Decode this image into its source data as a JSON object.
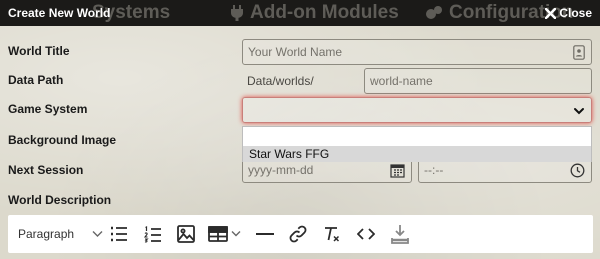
{
  "header": {
    "title": "Create New World",
    "bg_tabs": [
      "Systems",
      "Add-on Modules",
      "Configuration"
    ],
    "close_label": "Close"
  },
  "form": {
    "world_title": {
      "label": "World Title",
      "placeholder": "Your World Name",
      "value": ""
    },
    "data_path": {
      "label": "Data Path",
      "prefix": "Data/worlds/",
      "placeholder": "world-name",
      "value": ""
    },
    "game_system": {
      "label": "Game System",
      "selected": "",
      "options": [
        "Star Wars FFG"
      ]
    },
    "background_image": {
      "label": "Background Image"
    },
    "next_session": {
      "label": "Next Session",
      "date_placeholder": "yyyy-mm-dd",
      "time_placeholder": "--:--"
    },
    "world_description": {
      "label": "World Description"
    }
  },
  "editor": {
    "paragraph_label": "Paragraph",
    "tools": [
      "bulleted-list-icon",
      "numbered-list-icon",
      "image-icon",
      "table-icon",
      "horizontal-rule-icon",
      "link-icon",
      "clear-formatting-icon",
      "code-icon",
      "save-icon"
    ]
  },
  "colors": {
    "header_bg": "#1b1a18",
    "focus_glow": "#e2524a",
    "parchment": "#dcd9cc"
  }
}
